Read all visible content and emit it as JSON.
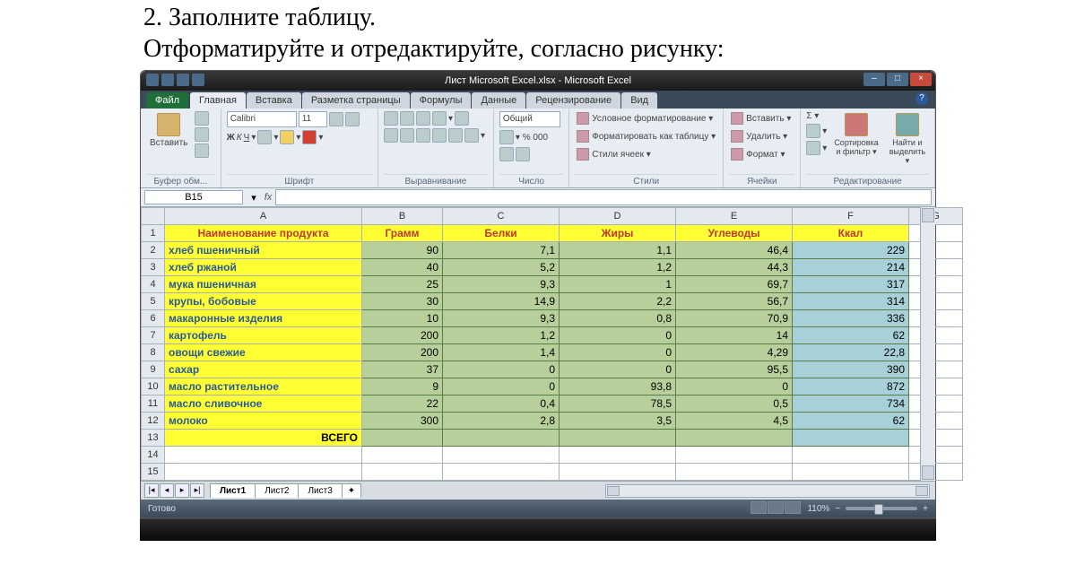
{
  "instruction": {
    "line1": "2. Заполните таблицу.",
    "line2": "Отформатируйте и отредактируйте, согласно рисунку:"
  },
  "window": {
    "title": "Лист Microsoft Excel.xlsx - Microsoft Excel"
  },
  "tabs": {
    "file": "Файл",
    "items": [
      "Главная",
      "Вставка",
      "Разметка страницы",
      "Формулы",
      "Данные",
      "Рецензирование",
      "Вид"
    ],
    "active": 0
  },
  "ribbon": {
    "clipboard": {
      "paste": "Вставить",
      "label": "Буфер обм..."
    },
    "font": {
      "name": "Calibri",
      "size": "11",
      "bold": "Ж",
      "italic": "К",
      "underline": "Ч",
      "label": "Шрифт"
    },
    "alignment": {
      "label": "Выравнивание"
    },
    "number": {
      "format": "Общий",
      "label": "Число"
    },
    "styles": {
      "cond": "Условное форматирование ▾",
      "table": "Форматировать как таблицу ▾",
      "cell": "Стили ячеек ▾",
      "label": "Стили"
    },
    "cells": {
      "insert": "Вставить ▾",
      "delete": "Удалить ▾",
      "format": "Формат ▾",
      "label": "Ячейки"
    },
    "editing": {
      "sort": "Сортировка и фильтр ▾",
      "find": "Найти и выделить ▾",
      "label": "Редактирование"
    }
  },
  "namebox": {
    "cell": "B15",
    "fx": "fx"
  },
  "columns": [
    "A",
    "B",
    "C",
    "D",
    "E",
    "F",
    "G"
  ],
  "headers": {
    "A": "Наименование продукта",
    "B": "Грамм",
    "C": "Белки",
    "D": "Жиры",
    "E": "Углеводы",
    "F": "Ккал"
  },
  "rows": [
    {
      "n": 2,
      "name": "хлеб пшеничный",
      "g": "90",
      "p": "7,1",
      "f": "1,1",
      "c": "46,4",
      "k": "229"
    },
    {
      "n": 3,
      "name": "хлеб ржаной",
      "g": "40",
      "p": "5,2",
      "f": "1,2",
      "c": "44,3",
      "k": "214"
    },
    {
      "n": 4,
      "name": "мука пшеничная",
      "g": "25",
      "p": "9,3",
      "f": "1",
      "c": "69,7",
      "k": "317"
    },
    {
      "n": 5,
      "name": "крупы, бобовые",
      "g": "30",
      "p": "14,9",
      "f": "2,2",
      "c": "56,7",
      "k": "314"
    },
    {
      "n": 6,
      "name": "макаронные изделия",
      "g": "10",
      "p": "9,3",
      "f": "0,8",
      "c": "70,9",
      "k": "336"
    },
    {
      "n": 7,
      "name": "картофель",
      "g": "200",
      "p": "1,2",
      "f": "0",
      "c": "14",
      "k": "62"
    },
    {
      "n": 8,
      "name": "овощи свежие",
      "g": "200",
      "p": "1,4",
      "f": "0",
      "c": "4,29",
      "k": "22,8"
    },
    {
      "n": 9,
      "name": "сахар",
      "g": "37",
      "p": "0",
      "f": "0",
      "c": "95,5",
      "k": "390"
    },
    {
      "n": 10,
      "name": "масло растительное",
      "g": "9",
      "p": "0",
      "f": "93,8",
      "c": "0",
      "k": "872"
    },
    {
      "n": 11,
      "name": "масло сливочное",
      "g": "22",
      "p": "0,4",
      "f": "78,5",
      "c": "0,5",
      "k": "734"
    },
    {
      "n": 12,
      "name": "молоко",
      "g": "300",
      "p": "2,8",
      "f": "3,5",
      "c": "4,5",
      "k": "62"
    }
  ],
  "total_label": "ВСЕГО",
  "sheet_tabs": [
    "Лист1",
    "Лист2",
    "Лист3"
  ],
  "status": {
    "ready": "Готово",
    "zoom": "110%"
  }
}
